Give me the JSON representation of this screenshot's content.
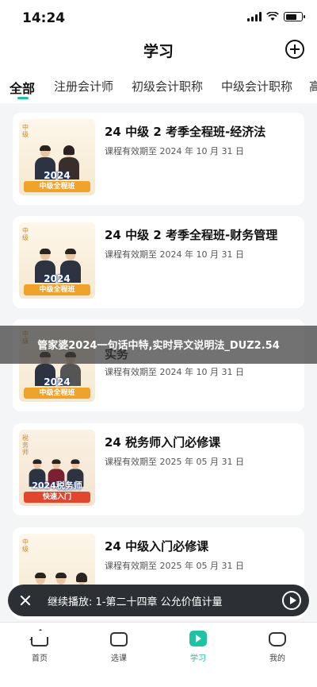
{
  "status_bar": {
    "time": "14:24"
  },
  "header": {
    "title": "学习"
  },
  "tabs": [
    {
      "label": "全部",
      "active": true
    },
    {
      "label": "注册会计师"
    },
    {
      "label": "初级会计职称"
    },
    {
      "label": "中级会计职称"
    },
    {
      "label": "高"
    }
  ],
  "courses": [
    {
      "title": "24 中级 2 考季全程班-经济法",
      "expiry": "课程有效期至 2024 年 10 月 31 日",
      "thumb_tag": "中级",
      "thumb_year": "2024",
      "thumb_label": "中级全程班"
    },
    {
      "title": "24 中级 2 考季全程班-财务管理",
      "expiry": "课程有效期至 2024 年 10 月 31 日",
      "thumb_tag": "中级",
      "thumb_year": "2024",
      "thumb_label": "中级全程班"
    },
    {
      "title": "实务",
      "expiry": "课程有效期至 2024 年 10 月 31 日",
      "thumb_tag": "中级",
      "thumb_year": "2024",
      "thumb_label": "中级全程班"
    },
    {
      "title": "24 税务师入门必修课",
      "expiry": "课程有效期至 2025 年 05 月 31 日",
      "thumb_tag": "税务师",
      "thumb_year": "2024税务师",
      "thumb_label": "快速入门"
    },
    {
      "title": "24 中级入门必修课",
      "expiry": "课程有效期至 2025 年 05 月 31 日",
      "thumb_tag": "中级",
      "thumb_year": "",
      "thumb_label": ""
    }
  ],
  "overlay": {
    "text": "管家婆2024一句话中特,实时异文说明法_DUZ2.54"
  },
  "resume": {
    "text": "继续播放: 1-第二十四章 公允价值计量"
  },
  "bottom_nav": [
    {
      "label": "首页",
      "icon": "home-icon"
    },
    {
      "label": "选课",
      "icon": "bag-icon"
    },
    {
      "label": "学习",
      "icon": "play-icon",
      "active": true
    },
    {
      "label": "我的",
      "icon": "profile-icon"
    }
  ],
  "colors": {
    "accent": "#1fc3a3",
    "badge": "#f0a32a"
  }
}
